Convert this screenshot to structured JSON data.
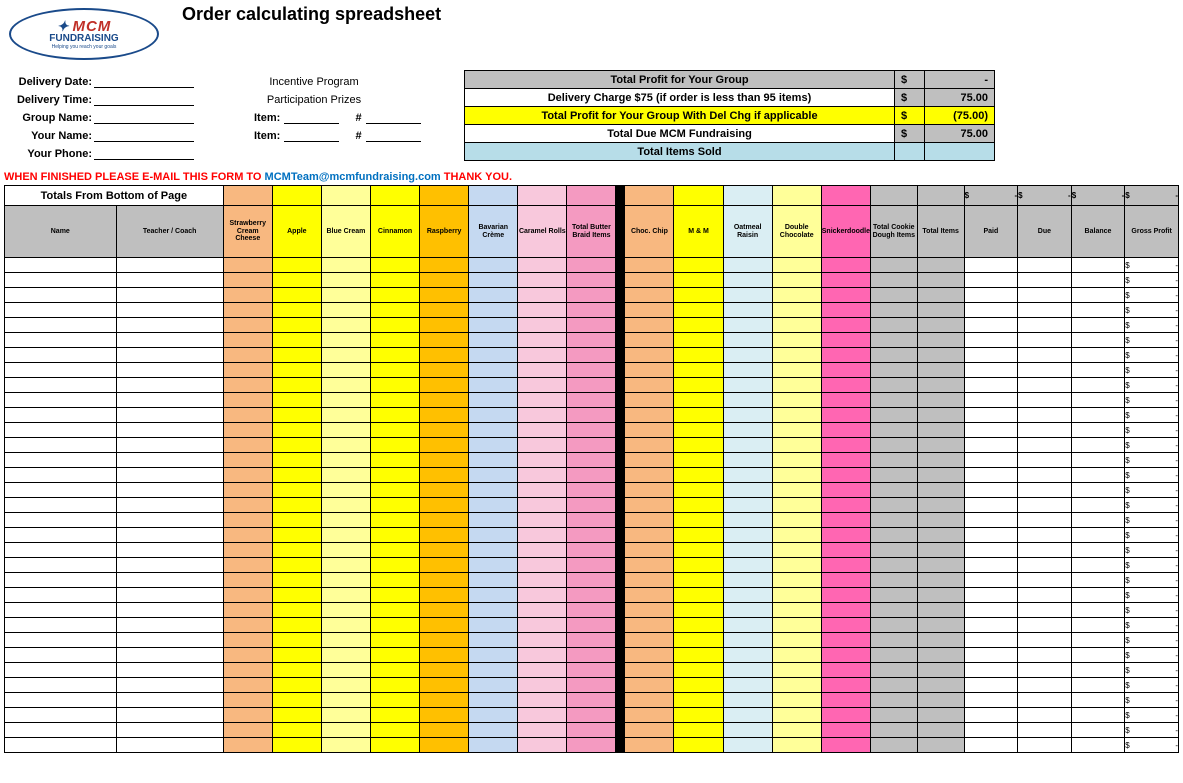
{
  "logo": {
    "line1": "MCM",
    "line2": "FUNDRAISING",
    "tagline": "Helping you reach your goals"
  },
  "title": "Order calculating spreadsheet",
  "form": {
    "labels": {
      "delivery_date": "Delivery Date:",
      "delivery_time": "Delivery Time:",
      "group_name": "Group Name:",
      "your_name": "Your Name:",
      "your_phone": "Your Phone:",
      "item": "Item:",
      "hash": "#"
    },
    "incentive_line1": "Incentive Program",
    "incentive_line2": "Participation Prizes"
  },
  "summary": {
    "rows": [
      {
        "label": "Total Profit for Your Group",
        "currency": "$",
        "value": "-",
        "label_bg": "c-gray",
        "val_bg": "c-gray"
      },
      {
        "label": "Delivery Charge $75 (if order is less than 95 items)",
        "currency": "$",
        "value": "75.00",
        "label_bg": "c-white",
        "val_bg": "c-gray"
      },
      {
        "label": "Total Profit for Your Group With Del Chg if applicable",
        "currency": "$",
        "value": "(75.00)",
        "label_bg": "yellow-bg",
        "val_bg": "yellow-bg"
      },
      {
        "label": "Total Due MCM Fundraising",
        "currency": "$",
        "value": "75.00",
        "label_bg": "c-white",
        "val_bg": "c-gray"
      },
      {
        "label": "Total Items Sold",
        "currency": "",
        "value": "",
        "label_bg": "teal-bg",
        "val_bg": "teal-bg"
      }
    ]
  },
  "email_line": {
    "prefix": "WHEN FINISHED PLEASE E-MAIL THIS FORM TO ",
    "email": "MCMTeam@mcmfundraising.com",
    "suffix": " THANK  YOU."
  },
  "grid": {
    "totals_strip_label": "Totals From Bottom of Page",
    "strip_money_cols": [
      "$",
      "$",
      "$",
      "$"
    ],
    "strip_dash": "-",
    "columns": [
      {
        "key": "name",
        "label": "Name",
        "cls": "c-gray",
        "w": "w-name"
      },
      {
        "key": "teacher",
        "label": "Teacher / Coach",
        "cls": "c-gray",
        "w": "w-teach"
      },
      {
        "key": "straw",
        "label": "Strawberry Cream Cheese",
        "cls": "c-peach",
        "w": "w-prod"
      },
      {
        "key": "apple",
        "label": "Apple",
        "cls": "c-yellow",
        "w": "w-prod"
      },
      {
        "key": "blue",
        "label": "Blue Cream",
        "cls": "c-ltyel",
        "w": "w-prod"
      },
      {
        "key": "cinn",
        "label": "Cinnamon",
        "cls": "c-yellow",
        "w": "w-prod"
      },
      {
        "key": "rasp",
        "label": "Raspberry",
        "cls": "c-orange",
        "w": "w-prod"
      },
      {
        "key": "bav",
        "label": "Bavarian Crème",
        "cls": "c-ltblue",
        "w": "w-prod"
      },
      {
        "key": "caramel",
        "label": "Caramel Rolls",
        "cls": "c-ltpink",
        "w": "w-prod"
      },
      {
        "key": "tbb",
        "label": "Total Butter Braid Items",
        "cls": "c-pink",
        "w": "w-prod"
      },
      {
        "key": "sep",
        "label": "",
        "cls": "c-black",
        "w": "w-sep"
      },
      {
        "key": "choc",
        "label": "Choc. Chip",
        "cls": "c-peach",
        "w": "w-prod"
      },
      {
        "key": "mm",
        "label": "M & M",
        "cls": "c-yellow",
        "w": "w-prod"
      },
      {
        "key": "oat",
        "label": "Oatmeal Raisin",
        "cls": "c-paleblue",
        "w": "w-prod"
      },
      {
        "key": "dbl",
        "label": "Double Chocolate",
        "cls": "c-ltyel",
        "w": "w-prod"
      },
      {
        "key": "snick",
        "label": "Snickerdoodle",
        "cls": "c-hotpink",
        "w": "w-prod"
      },
      {
        "key": "tcd",
        "label": "Total Cookie Dough Items",
        "cls": "c-gray",
        "w": "w-tot"
      },
      {
        "key": "titems",
        "label": "Total Items",
        "cls": "c-gray",
        "w": "w-tot"
      },
      {
        "key": "paid",
        "label": "Paid",
        "cls": "c-gray",
        "w": "w-money",
        "money": true
      },
      {
        "key": "due",
        "label": "Due",
        "cls": "c-gray",
        "w": "w-money",
        "money": true
      },
      {
        "key": "bal",
        "label": "Balance",
        "cls": "c-gray",
        "w": "w-money",
        "money": true
      },
      {
        "key": "gp",
        "label": "Gross Profit",
        "cls": "c-gray",
        "w": "w-money",
        "money": true
      }
    ],
    "row_count": 33,
    "money_currency": "$",
    "money_dash": "-"
  }
}
